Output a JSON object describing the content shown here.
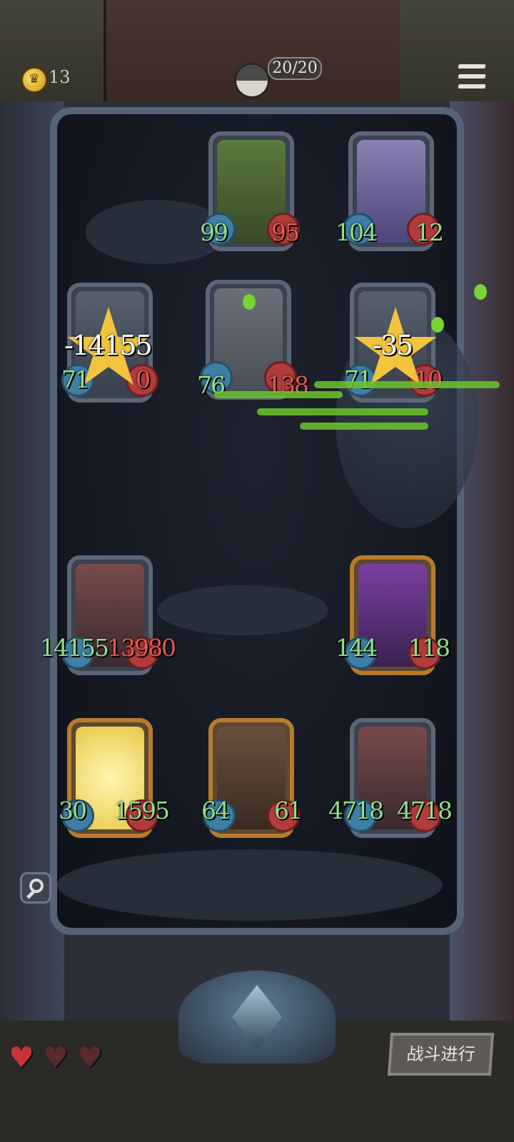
{
  "header": {
    "gold": "13",
    "health": "20/20"
  },
  "slots": {
    "enemy_top_1": {
      "name": "pink-hair-tinkerer",
      "atk": "99",
      "hp": "95"
    },
    "enemy_top_2": {
      "name": "skeleton-pharaoh",
      "atk": "104",
      "hp": "12"
    },
    "enemy_mid_1": {
      "name": "wolf-soldier-left",
      "atk": "71",
      "hp": "0",
      "damage": "-14155"
    },
    "enemy_mid_2": {
      "name": "wolf-soldier-center",
      "atk": "76",
      "hp": "138"
    },
    "enemy_mid_3": {
      "name": "wolf-soldier-right",
      "atk": "71",
      "hp": "10",
      "damage": "-35"
    },
    "ally_front_1": {
      "name": "brawler",
      "atk": "14155",
      "hp": "13980"
    },
    "ally_front_2": {
      "name": "witch",
      "atk": "144",
      "hp": "118"
    },
    "ally_back_1": {
      "name": "lightning-dwarf",
      "atk": "30",
      "hp": "1595"
    },
    "ally_back_2": {
      "name": "masked-rabbit",
      "atk": "64",
      "hp": "61"
    },
    "ally_back_3": {
      "name": "brawler-2",
      "atk": "4718",
      "hp": "4718"
    }
  },
  "footer": {
    "battle_label": "战斗进行",
    "hearts": [
      "filled",
      "empty",
      "empty"
    ]
  },
  "colors": {
    "atk": "#8fe08a",
    "hp_damaged": "#e05a50",
    "accent_gold": "#f2c43d"
  }
}
